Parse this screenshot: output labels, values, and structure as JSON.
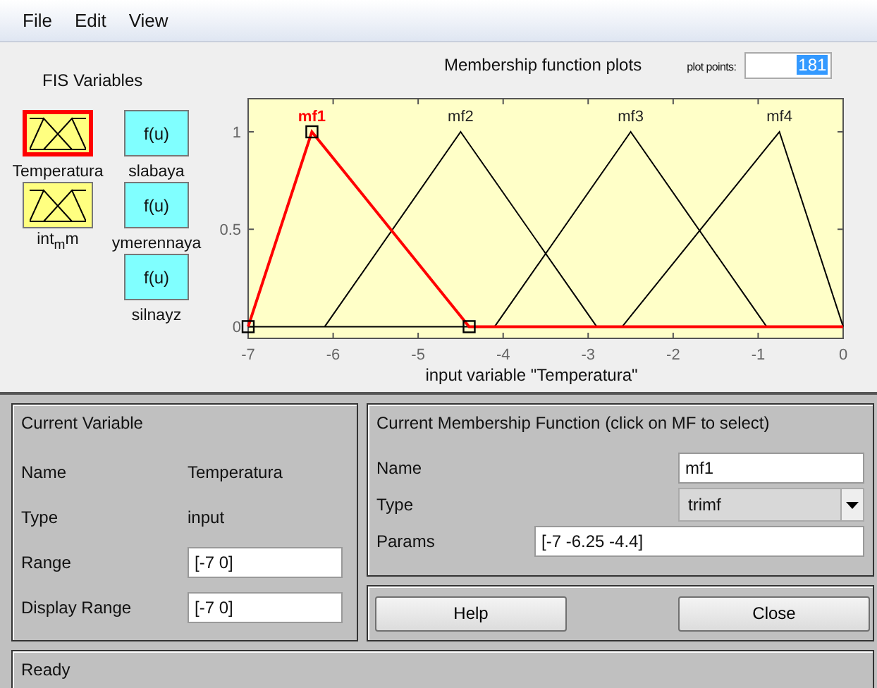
{
  "menu": [
    "File",
    "Edit",
    "View"
  ],
  "fis_variables": {
    "title": "FIS Variables",
    "inputs": [
      {
        "name": "Temperatura",
        "selected": true
      },
      {
        "name": "int$_{m}$m",
        "selected": false
      }
    ],
    "outputs": [
      {
        "name": "slabaya",
        "label": "f(u)",
        "selected": false
      },
      {
        "name": "ymerennaya",
        "label": "f(u)",
        "selected": false
      },
      {
        "name": "silnayz",
        "label": "f(u)",
        "selected": false
      }
    ]
  },
  "plot": {
    "title": "Membership function plots",
    "plot_points_label": "plot points:",
    "plot_points": "181",
    "membership_functions": [
      {
        "selected": true
      },
      {
        "selected": false
      },
      {
        "selected": false
      },
      {
        "selected": false
      }
    ],
    "chart_data": {
      "type": "line",
      "xlabel": "input variable \"Temperatura\"",
      "x": [
        -7,
        -6.25,
        -6.1,
        -4.5,
        -4.4,
        -4.1,
        -2.9,
        -2.6,
        -2.5,
        -0.9,
        -0.75,
        0
      ],
      "series": [
        {
          "name": "mf1",
          "color": "#ff0000",
          "values": [
            0,
            1,
            0.919,
            0.054,
            0,
            0,
            0,
            0,
            0,
            0,
            0,
            0
          ]
        },
        {
          "name": "mf2",
          "color": "#000000",
          "values": [
            null,
            null,
            0,
            1,
            0.938,
            0.75,
            0,
            null,
            null,
            null,
            null,
            null
          ]
        },
        {
          "name": "mf3",
          "color": "#000000",
          "values": [
            null,
            null,
            null,
            null,
            null,
            0,
            0.75,
            0.938,
            1,
            0,
            null,
            null
          ]
        },
        {
          "name": "mf4",
          "color": "#000000",
          "values": [
            null,
            null,
            null,
            null,
            null,
            null,
            null,
            0,
            0.054,
            0.919,
            1,
            0
          ]
        }
      ],
      "xlim": [
        -7,
        0
      ],
      "ylim": [
        -0.06,
        1.17
      ],
      "xticks": [
        -7,
        -6,
        -5,
        -4,
        -3,
        -2,
        -1,
        0
      ],
      "yticks": [
        0,
        {
          "value": 0.5,
          "label": "0.5"
        },
        1
      ]
    }
  },
  "current_variable": {
    "title": "Current Variable",
    "fields": [
      {
        "label": "Name",
        "value": "Temperatura",
        "kind": "text"
      },
      {
        "label": "Type",
        "value": "input",
        "kind": "text"
      },
      {
        "label": "Range",
        "value": "[-7 0]",
        "kind": "input"
      },
      {
        "label": "Display Range",
        "value": "[-7 0]",
        "kind": "input"
      }
    ]
  },
  "current_mf": {
    "title": "Current Membership Function (click on MF to select)",
    "name_label": "Name",
    "name": "mf1",
    "type_label": "Type",
    "type": "trimf",
    "params_label": "Params",
    "params": "[-7 -6.25 -4.4]"
  },
  "buttons": [
    "Help",
    "Close"
  ],
  "status": "Ready"
}
